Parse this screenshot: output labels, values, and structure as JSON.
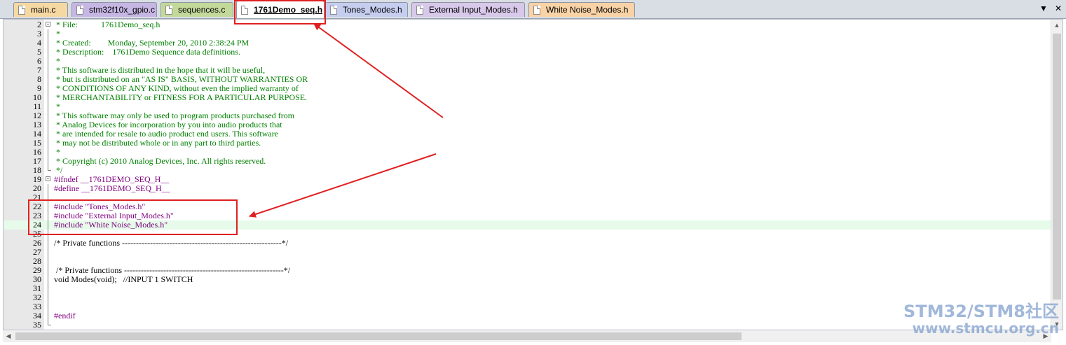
{
  "tabs": [
    {
      "label": "main.c",
      "color": "#f6d9a2",
      "active": false
    },
    {
      "label": "stm32f10x_gpio.c",
      "color": "#c6b6e3",
      "active": false
    },
    {
      "label": "sequences.c",
      "color": "#c3d99a",
      "active": false
    },
    {
      "label": "1761Demo_seq.h",
      "color": "#ffffff",
      "active": true
    },
    {
      "label": "Tones_Modes.h",
      "color": "#c6cef0",
      "active": false
    },
    {
      "label": "External Input_Modes.h",
      "color": "#d8c8ea",
      "active": false
    },
    {
      "label": "White Noise_Modes.h",
      "color": "#f9d3a6",
      "active": false
    }
  ],
  "tab_controls": {
    "dropdown": "▼",
    "close": "✕"
  },
  "editor": {
    "current_line": 24,
    "lines": [
      {
        "n": "2",
        "text": " * File:           1761Demo_seq.h",
        "kind": "comment"
      },
      {
        "n": "3",
        "text": " *",
        "kind": "comment"
      },
      {
        "n": "4",
        "text": " * Created:        Monday, September 20, 2010 2:38:24 PM",
        "kind": "comment"
      },
      {
        "n": "5",
        "text": " * Description:    1761Demo Sequence data definitions.",
        "kind": "comment"
      },
      {
        "n": "6",
        "text": " *",
        "kind": "comment"
      },
      {
        "n": "7",
        "text": " * This software is distributed in the hope that it will be useful,",
        "kind": "comment"
      },
      {
        "n": "8",
        "text": " * but is distributed on an \"AS IS\" BASIS, WITHOUT WARRANTIES OR",
        "kind": "comment"
      },
      {
        "n": "9",
        "text": " * CONDITIONS OF ANY KIND, without even the implied warranty of",
        "kind": "comment"
      },
      {
        "n": "10",
        "text": " * MERCHANTABILITY or FITNESS FOR A PARTICULAR PURPOSE.",
        "kind": "comment"
      },
      {
        "n": "11",
        "text": " *",
        "kind": "comment"
      },
      {
        "n": "12",
        "text": " * This software may only be used to program products purchased from",
        "kind": "comment"
      },
      {
        "n": "13",
        "text": " * Analog Devices for incorporation by you into audio products that",
        "kind": "comment"
      },
      {
        "n": "14",
        "text": " * are intended for resale to audio product end users. This software",
        "kind": "comment"
      },
      {
        "n": "15",
        "text": " * may not be distributed whole or in any part to third parties.",
        "kind": "comment"
      },
      {
        "n": "16",
        "text": " *",
        "kind": "comment"
      },
      {
        "n": "17",
        "text": " * Copyright (c) 2010 Analog Devices, Inc. All rights reserved.",
        "kind": "comment"
      },
      {
        "n": "18",
        "text": " */",
        "kind": "comment"
      },
      {
        "n": "19",
        "text": "#ifndef __1761DEMO_SEQ_H__",
        "kind": "preproc"
      },
      {
        "n": "20",
        "text": "#define __1761DEMO_SEQ_H__",
        "kind": "preproc"
      },
      {
        "n": "21",
        "text": "",
        "kind": "default"
      },
      {
        "n": "22",
        "text": "#include \"Tones_Modes.h\"",
        "kind": "preproc"
      },
      {
        "n": "23",
        "text": "#include \"External Input_Modes.h\"",
        "kind": "preproc"
      },
      {
        "n": "24",
        "text": "#include \"White Noise_Modes.h\"",
        "kind": "preproc"
      },
      {
        "n": "25",
        "text": "",
        "kind": "default"
      },
      {
        "n": "26",
        "text": "/* Private functions ---------------------------------------------------------*/",
        "kind": "default"
      },
      {
        "n": "27",
        "text": "",
        "kind": "default"
      },
      {
        "n": "28",
        "text": "",
        "kind": "default"
      },
      {
        "n": "29",
        "text": " /* Private functions ---------------------------------------------------------*/",
        "kind": "default"
      },
      {
        "n": "30",
        "text": "void Modes(void);   //INPUT 1 SWITCH",
        "kind": "default"
      },
      {
        "n": "31",
        "text": "",
        "kind": "default"
      },
      {
        "n": "32",
        "text": "",
        "kind": "default"
      },
      {
        "n": "33",
        "text": "",
        "kind": "default"
      },
      {
        "n": "34",
        "text": "#endif",
        "kind": "preproc"
      },
      {
        "n": "35",
        "text": "",
        "kind": "default"
      }
    ]
  },
  "colors": {
    "comment": "#008000",
    "preproc": "#800080",
    "annotation": "#e02020",
    "current_line_bg": "#e6fbe9"
  },
  "watermark": {
    "line1": "STM32/STM8社区",
    "line2": "www.stmcu.org.cn"
  }
}
